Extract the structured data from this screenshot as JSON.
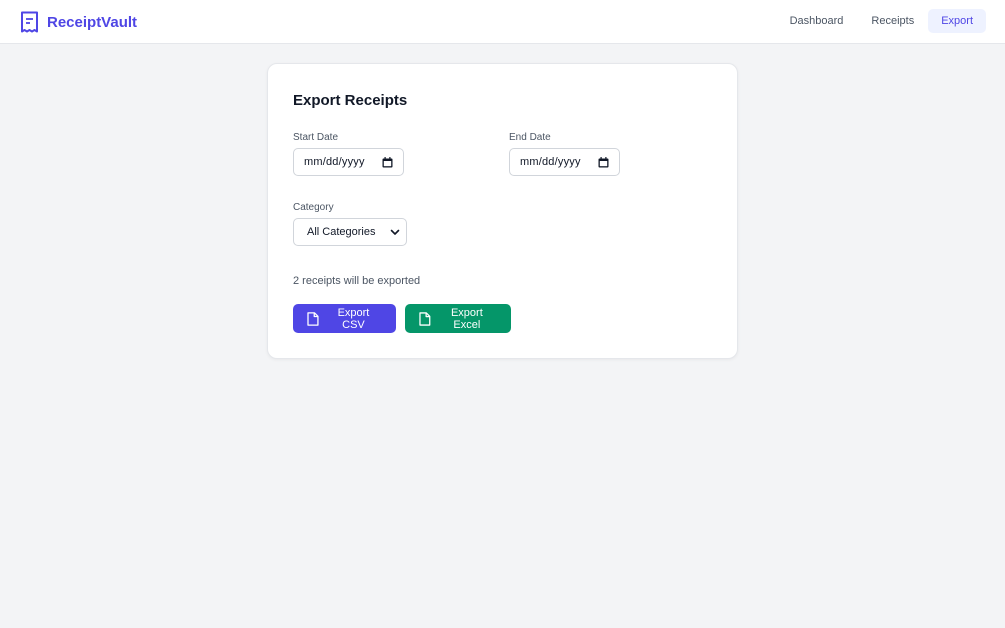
{
  "app": {
    "name": "ReceiptVault",
    "logo_icon": "receipt-icon",
    "brand_color": "#4f46e5"
  },
  "nav": {
    "items": [
      {
        "label": "Dashboard",
        "active": false
      },
      {
        "label": "Receipts",
        "active": false
      },
      {
        "label": "Export",
        "active": true
      }
    ]
  },
  "export": {
    "title": "Export Receipts",
    "start_date": {
      "label": "Start Date",
      "value": "mm/dd/yyyy",
      "icon": "calendar-icon"
    },
    "end_date": {
      "label": "End Date",
      "value": "mm/dd/yyyy",
      "icon": "calendar-icon"
    },
    "category": {
      "label": "Category",
      "selected": "All Categories",
      "icon": "chevron-down-icon"
    },
    "count_text": "2 receipts will be exported",
    "csv_button": {
      "label": "Export CSV",
      "icon": "file-icon",
      "color": "#4f46e5"
    },
    "excel_button": {
      "label": "Export Excel",
      "icon": "file-icon",
      "color": "#059669"
    }
  }
}
